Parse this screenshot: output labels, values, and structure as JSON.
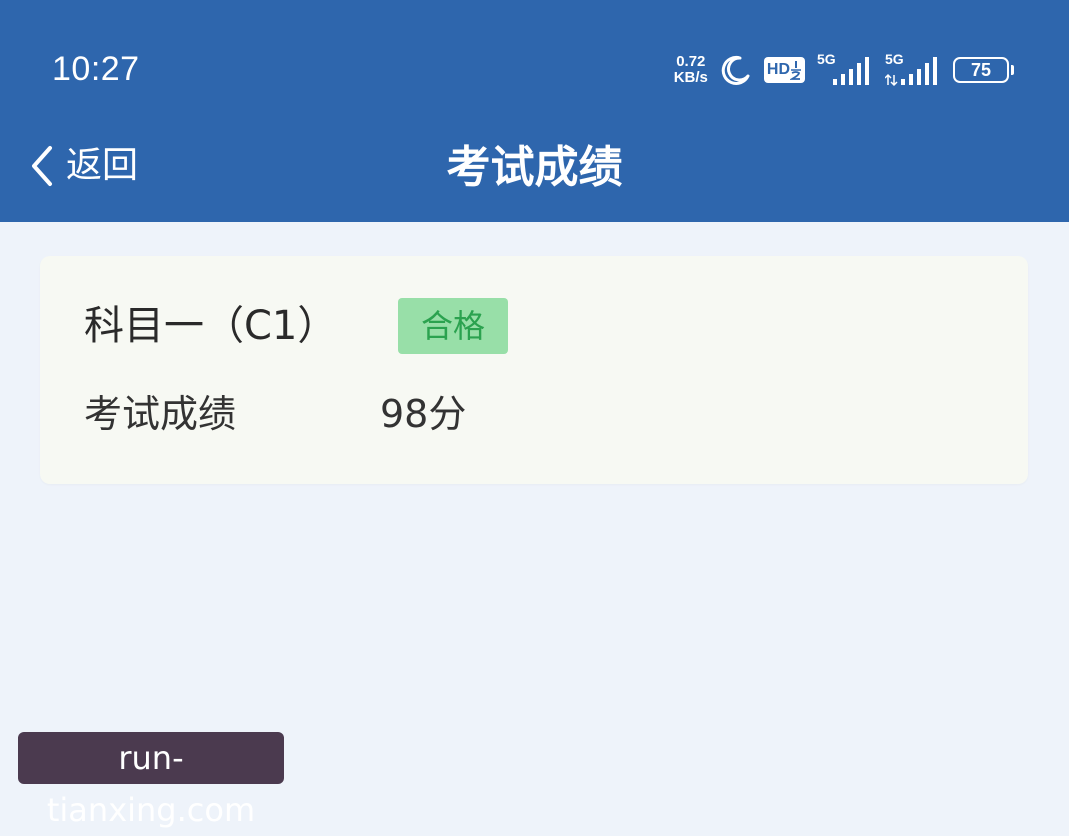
{
  "status_bar": {
    "time": "10:27",
    "net_speed_value": "0.72",
    "net_speed_unit": "KB/s",
    "hd_label": "HD",
    "sim1_label": "5G",
    "sim2_label": "5G",
    "battery_level": "75",
    "icons": [
      "moon-icon",
      "hd-icon",
      "signal-icon",
      "signal-icon",
      "battery-icon"
    ]
  },
  "nav": {
    "back_label": "返回",
    "title": "考试成绩"
  },
  "result_card": {
    "subject": "科目一（C1）",
    "status_badge": "合格",
    "score_label": "考试成绩",
    "score_value": "98分"
  },
  "watermark": "run-tianxing.com",
  "colors": {
    "header_bg": "#2e66ad",
    "page_bg": "#eef3fa",
    "card_bg": "#f7f9f3",
    "badge_bg": "#98dfa8",
    "badge_text": "#2ba24f"
  }
}
